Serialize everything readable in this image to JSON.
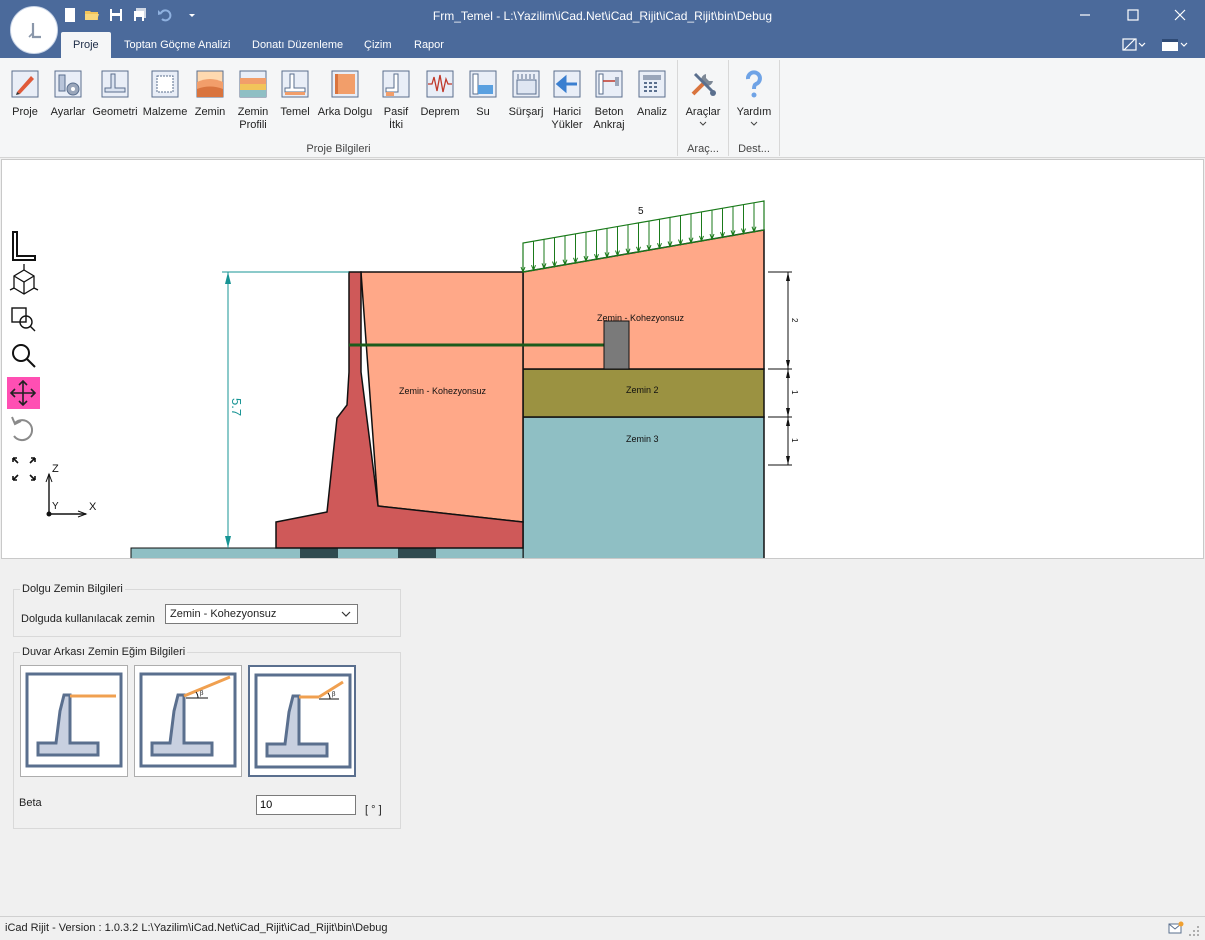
{
  "window": {
    "title": "Frm_Temel - L:\\Yazilim\\iCad.Net\\iCad_Rijit\\iCad_Rijit\\bin\\Debug"
  },
  "tabs": [
    {
      "label": "Proje",
      "active": true
    },
    {
      "label": "Toptan Göçme Analizi",
      "active": false
    },
    {
      "label": "Donatı Düzenleme",
      "active": false
    },
    {
      "label": "Çizim",
      "active": false
    },
    {
      "label": "Rapor",
      "active": false
    }
  ],
  "ribbon": {
    "buttons": [
      {
        "label": "Proje",
        "icon": "project-icon"
      },
      {
        "label": "Ayarlar",
        "icon": "settings-icon"
      },
      {
        "label": "Geometri",
        "icon": "geometry-icon"
      },
      {
        "label": "Malzeme",
        "icon": "material-icon"
      },
      {
        "label": "Zemin",
        "icon": "soil-icon"
      },
      {
        "label": "Zemin Profili",
        "line1": "Zemin",
        "line2": "Profili",
        "icon": "soil-profile-icon"
      },
      {
        "label": "Temel",
        "icon": "foundation-icon"
      },
      {
        "label": "Arka Dolgu",
        "icon": "backfill-icon"
      },
      {
        "label": "Pasif İtki",
        "line1": "Pasif",
        "line2": "İtki",
        "icon": "passive-thrust-icon"
      },
      {
        "label": "Deprem",
        "icon": "earthquake-icon"
      },
      {
        "label": "Su",
        "icon": "water-icon"
      },
      {
        "label": "Sürşarj",
        "icon": "surcharge-icon"
      },
      {
        "label": "Harici Yükler",
        "line1": "Harici",
        "line2": "Yükler",
        "icon": "external-loads-icon"
      },
      {
        "label": "Beton Ankraj",
        "line1": "Beton",
        "line2": "Ankraj",
        "icon": "concrete-anchor-icon"
      },
      {
        "label": "Analiz",
        "icon": "analysis-icon"
      }
    ],
    "tools": {
      "label": "Araçlar",
      "icon": "tools-icon"
    },
    "help": {
      "label": "Yardım",
      "icon": "help-icon"
    },
    "groups": {
      "project": "Proje Bilgileri",
      "tools": "Araç...",
      "help": "Dest..."
    }
  },
  "drawing": {
    "surcharge_label": "5",
    "height_label": "5.7",
    "layer_labels": {
      "backfill": "Zemin - Kohezyonsuz",
      "upper": "Zemin - Kohezyonsuz",
      "layer2": "Zemin 2",
      "layer3": "Zemin 3"
    },
    "dim_labels": [
      "2",
      "1",
      "1"
    ],
    "axes": {
      "z": "Z",
      "y": "Y",
      "x": "X"
    },
    "colors": {
      "backfill": "#ffa888",
      "layer2": "#9b9241",
      "layer3": "#8fbfc4",
      "wall": "#cf5959",
      "dimension": "#179494",
      "surcharge": "#1a7a1a",
      "anchor": "#7a7a7a"
    }
  },
  "backfill_panel": {
    "title": "Dolgu Zemin Bilgileri",
    "field_label": "Dolguda kullanılacak zemin",
    "selected_value": "Zemin - Kohezyonsuz"
  },
  "slope_panel": {
    "title": "Duvar Arkası Zemin Eğim Bilgileri",
    "options": [
      "flat",
      "inclined",
      "partial-inclined"
    ],
    "selected_index": 2,
    "beta_glyph": "β",
    "beta_label": "Beta",
    "beta_value": "10",
    "unit": "[ ° ]"
  },
  "status": {
    "text": "iCad Rijit - Version : 1.0.3.2  L:\\Yazilim\\iCad.Net\\iCad_Rijit\\iCad_Rijit\\bin\\Debug"
  }
}
